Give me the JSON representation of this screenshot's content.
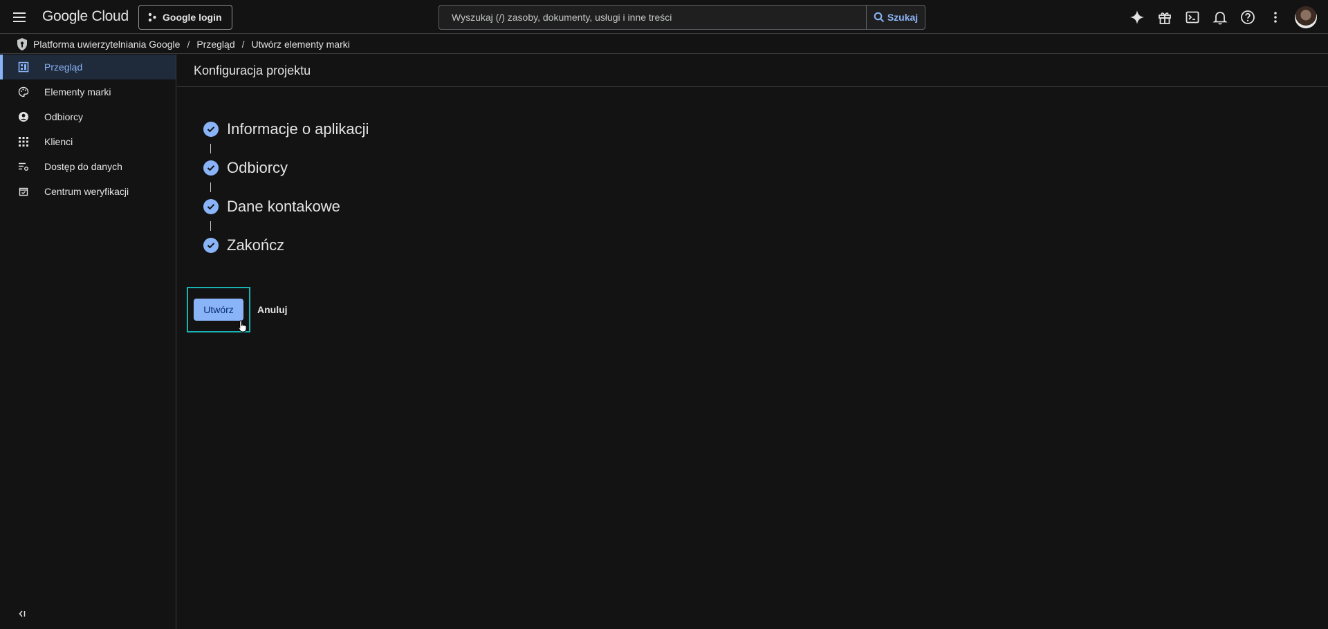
{
  "header": {
    "logo_text": "Google Cloud",
    "project_label": "Google login",
    "search_placeholder": "Wyszukaj (/) zasoby, dokumenty, usługi i inne treści",
    "search_button": "Szukaj",
    "icons": [
      "gemini-icon",
      "gift-icon",
      "terminal-icon",
      "bell-icon",
      "help-icon",
      "more-vert-icon"
    ]
  },
  "breadcrumb": {
    "items": [
      "Platforma uwierzytelniania Google",
      "Przegląd",
      "Utwórz elementy marki"
    ],
    "separator": "/"
  },
  "sidebar": {
    "items": [
      {
        "label": "Przegląd",
        "icon": "dashboard-icon",
        "active": true
      },
      {
        "label": "Elementy marki",
        "icon": "palette-icon"
      },
      {
        "label": "Odbiorcy",
        "icon": "person-circle-icon"
      },
      {
        "label": "Klienci",
        "icon": "apps-grid-icon"
      },
      {
        "label": "Dostęp do danych",
        "icon": "list-settings-icon"
      },
      {
        "label": "Centrum weryfikacji",
        "icon": "verified-calendar-icon"
      }
    ]
  },
  "main": {
    "title": "Konfiguracja projektu",
    "steps": [
      {
        "label": "Informacje o aplikacji",
        "status": "complete"
      },
      {
        "label": "Odbiorcy",
        "status": "complete"
      },
      {
        "label": "Dane kontakowe",
        "status": "complete"
      },
      {
        "label": "Zakończ",
        "status": "complete"
      }
    ],
    "create_button": "Utwórz",
    "cancel_button": "Anuluj"
  },
  "colors": {
    "background": "#131313",
    "accent": "#8ab4f8",
    "focus": "#1ab3b3",
    "text": "#e3e3e3"
  }
}
